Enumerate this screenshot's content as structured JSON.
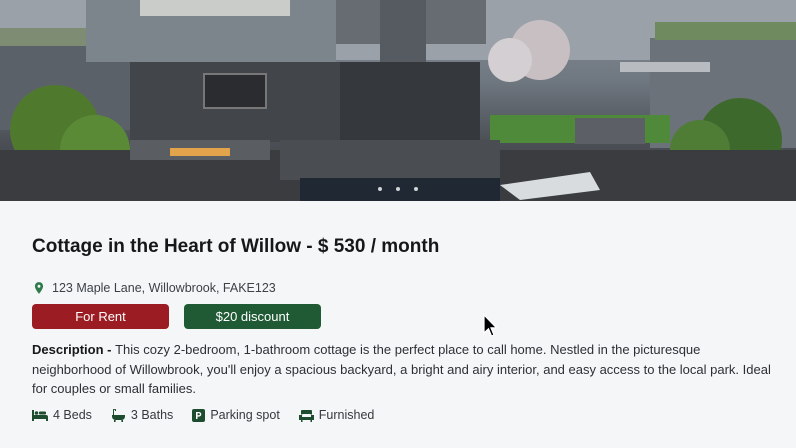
{
  "listing": {
    "title": "Cottage in the Heart of Willow - $ 530 / month",
    "address": "123 Maple Lane, Willowbrook, FAKE123",
    "badges": {
      "status": "For Rent",
      "discount": "$20 discount"
    },
    "description_label": "Description - ",
    "description": "This cozy 2-bedroom, 1-bathroom cottage is the perfect place to call home. Nestled in the picturesque neighborhood of Willowbrook, you'll enjoy a spacious backyard, a bright and airy interior, and easy access to the local park. Ideal for couples or small families.",
    "features": {
      "beds": "4 Beds",
      "baths": "3 Baths",
      "parking": "Parking spot",
      "furnished": "Furnished"
    }
  },
  "colors": {
    "status_badge": "#9b1c22",
    "discount_badge": "#1f5a35",
    "accent_green": "#2f7a4a"
  },
  "icons": {
    "address": "location-pin-icon",
    "beds": "bed-icon",
    "baths": "bathtub-icon",
    "parking": "parking-icon",
    "furnished": "armchair-icon"
  }
}
